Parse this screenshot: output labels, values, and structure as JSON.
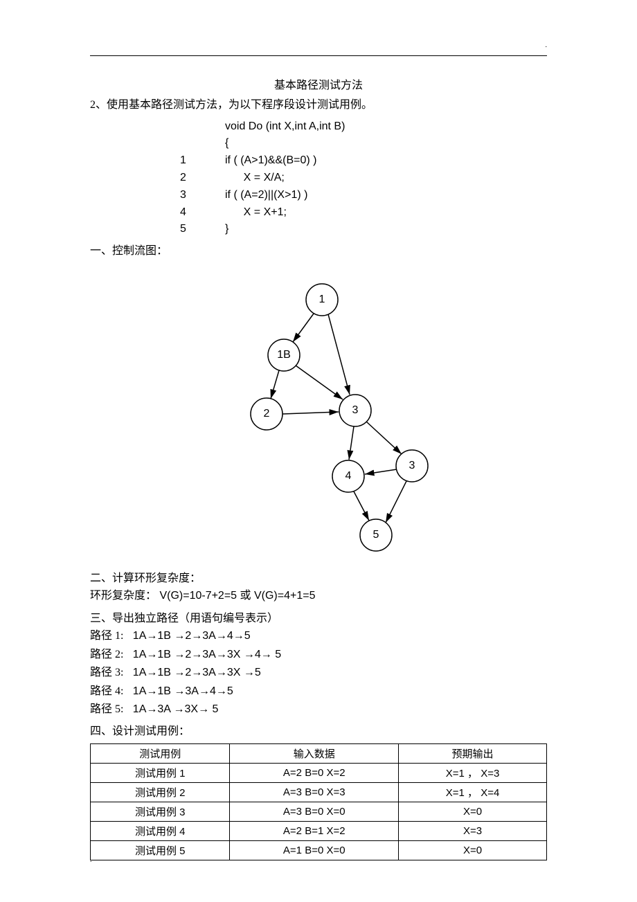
{
  "corner": ".",
  "title": "基本路径测试方法",
  "intro": "2、使用基本路径测试方法，为以下程序段设计测试用例。",
  "code": {
    "l0": "void Do (int X,int A,int B)",
    "l0b": "{",
    "n1": "1",
    "l1": "if ( (A>1)&&(B=0) )",
    "n2": "2",
    "l2": "X = X/A;",
    "n3": "3",
    "l3": "if ( (A=2)||(X>1) )",
    "n4": "4",
    "l4": "X = X+1;",
    "n5": "5",
    "l5": "}"
  },
  "sec1": "一、控制流图：",
  "graph": {
    "n1": "1",
    "n1b": "1B",
    "n2": "2",
    "n3a": "3",
    "n3b": "3",
    "n4": "4",
    "n5": "5"
  },
  "sec2": "二、计算环形复杂度：",
  "complexity": "环形复杂度：   V(G)=10-7+2=5    或  V(G)=4+1=5",
  "sec3": "三、导出独立路径（用语句编号表示）",
  "paths": {
    "p1l": "路径 1:",
    "p1": "1A→1B →2→3A→4→5",
    "p2l": "路径 2:",
    "p2": "1A→1B →2→3A→3X →4→ 5",
    "p3l": "路径 3:",
    "p3": "1A→1B →2→3A→3X →5",
    "p4l": "路径 4:",
    "p4": "1A→1B →3A→4→5",
    "p5l": "路径 5:",
    "p5": "1A→3A →3X→ 5"
  },
  "sec4": "四、设计测试用例：",
  "table": {
    "h1": "测试用例",
    "h2": "输入数据",
    "h3": "预期输出",
    "rows": [
      {
        "c": "测试用例  1",
        "in": "A=2    B=0    X=2",
        "out": "X=1 ， X=3"
      },
      {
        "c": "测试用例  2",
        "in": "A=3    B=0    X=3",
        "out": "X=1 ， X=4"
      },
      {
        "c": "测试用例  3",
        "in": "A=3    B=0    X=0",
        "out": "X=0"
      },
      {
        "c": "测试用例  4",
        "in": "A=2    B=1    X=2",
        "out": "X=3"
      },
      {
        "c": "测试用例  5",
        "in": "A=1    B=0    X=0",
        "out": "X=0"
      }
    ]
  },
  "bottom": "."
}
